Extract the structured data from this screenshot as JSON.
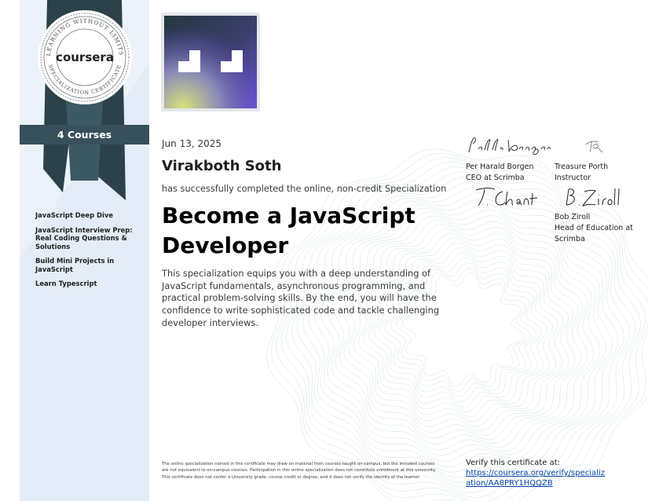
{
  "seal": {
    "brand": "coursera",
    "ring_text_top": "LEARNING WITHOUT LIMITS",
    "ring_text_bottom": "SPECIALIZATION CERTIFICATE"
  },
  "sidebar": {
    "courses_count_label": "4 Courses",
    "courses": [
      "JavaScript Deep Dive",
      "JavaScript Interview Prep: Real Coding Questions & Solutions",
      "Build Mini Projects in JavaScript",
      "Learn Typescript"
    ]
  },
  "certificate": {
    "date": "Jun 13, 2025",
    "recipient": "Virakboth Soth",
    "completed_text": "has successfully completed the online, non-credit Specialization",
    "title": "Become a JavaScript Developer",
    "description": "This specialization equips you with a deep understanding of JavaScript fundamentals, asynchronous programming, and practical problem-solving skills. By the end, you will have the confidence to write sophisticated code and tackle challenging developer interviews."
  },
  "signatories": [
    {
      "name": "Per Harald Borgen",
      "role": "CEO at Scrimba",
      "signature": "Per Harald Borgen"
    },
    {
      "name": "Treasure Porth",
      "role": "Instructor",
      "signature": "TP"
    },
    {
      "name": "Bob Ziroll",
      "role": "Head of Education at Scrimba",
      "signature": "B. Ziroll"
    }
  ],
  "extra_signature": "T. Chant",
  "footer": {
    "disclaimer": "The online specialization named in this certificate may draw on material from courses taught on-campus, but the included courses are not equivalent to on-campus courses. Participation in this online specialization does not constitute enrollment at this university. This certificate does not confer a University grade, course credit or degree, and it does not verify the identity of the learner.",
    "verify_label": "Verify this certificate at:",
    "verify_url": "https://coursera.org/verify/specialization/AA8PRY1HQQZB"
  },
  "colors": {
    "banner": "#38505a",
    "sidebar_bg": "#ebf2fa",
    "ribbon": "#2c4149",
    "link": "#0645ad"
  }
}
